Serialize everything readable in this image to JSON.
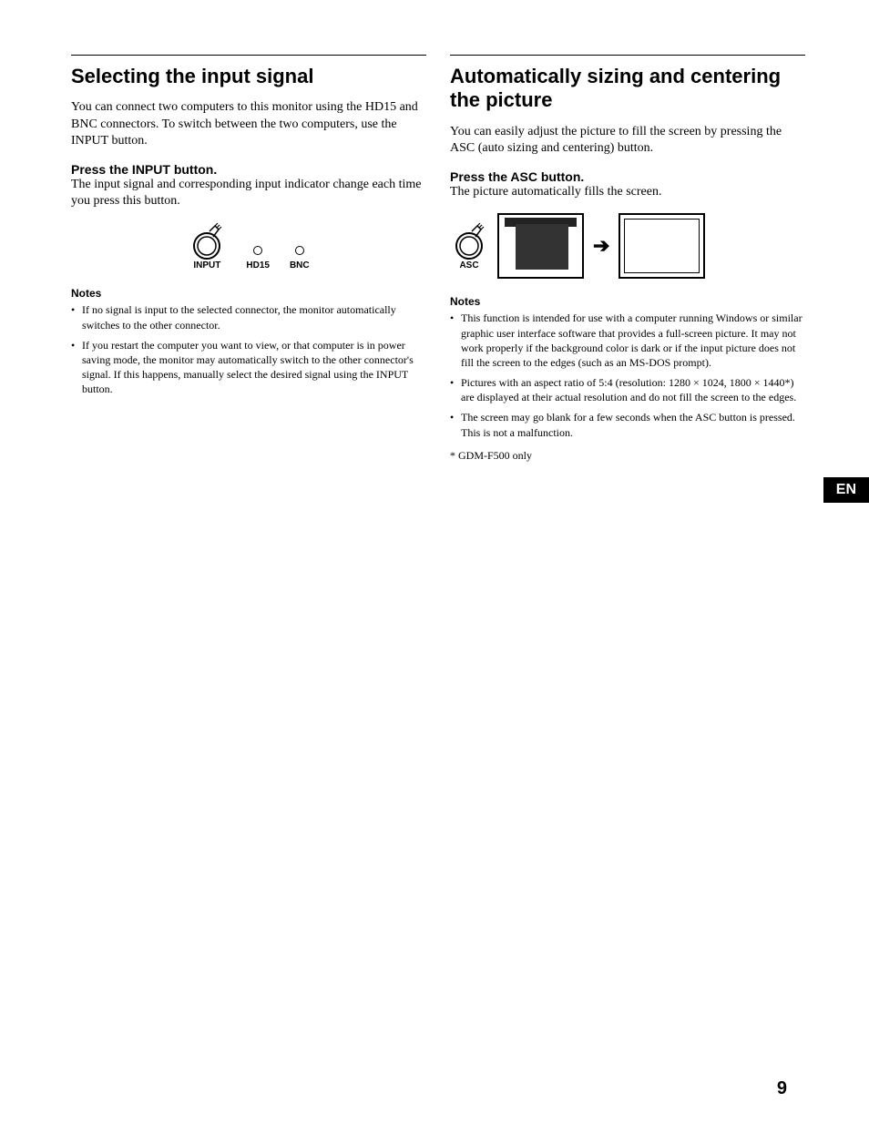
{
  "left": {
    "title": "Selecting the input signal",
    "intro": "You can connect two computers to this monitor using the HD15 and BNC connectors. To switch between the two computers, use the INPUT button.",
    "subhead": "Press the INPUT button.",
    "subbody": "The input signal and corresponding input indicator change each time you press this button.",
    "diagram": {
      "input_label": "INPUT",
      "hd15_label": "HD15",
      "bnc_label": "BNC"
    },
    "notes_head": "Notes",
    "notes": [
      "If no signal is input to the selected connector, the monitor automatically switches to the other connector.",
      "If you restart the computer you want to view, or that computer is in power saving mode, the monitor may automatically switch to the other connector's signal. If this happens, manually select the desired signal using the INPUT button."
    ]
  },
  "right": {
    "title": "Automatically sizing and centering the picture",
    "intro": "You can easily adjust the picture to fill the screen by pressing the ASC (auto sizing and centering) button.",
    "subhead": "Press the ASC button.",
    "subbody": "The picture automatically fills the screen.",
    "diagram": {
      "asc_label": "ASC",
      "arrow": "➔"
    },
    "notes_head": "Notes",
    "notes": [
      "This function is intended for use with a computer running Windows or similar graphic user interface software that provides a full-screen picture. It may not work properly if the background color is dark or if the input picture does not fill the screen to the edges (such as an MS-DOS prompt).",
      "Pictures with an aspect ratio of 5:4 (resolution: 1280 × 1024, 1800 × 1440*) are displayed at their actual resolution and do not fill the screen to the edges.",
      "The screen may go blank for a few seconds when the ASC button is pressed. This is not a malfunction."
    ],
    "footnote": "* GDM-F500 only"
  },
  "tab": "EN",
  "page_num": "9"
}
